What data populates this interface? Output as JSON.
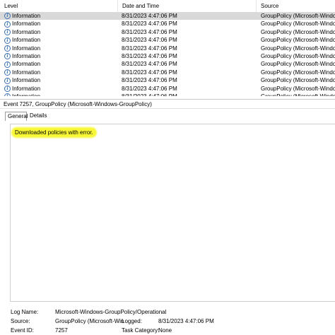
{
  "list": {
    "columns": [
      "Level",
      "Date and Time",
      "Source"
    ],
    "rows": [
      {
        "level": "Information",
        "date": "8/31/2023 4:47:06 PM",
        "source": "GroupPolicy (Microsoft-Windows",
        "selected": true
      },
      {
        "level": "Information",
        "date": "8/31/2023 4:47:06 PM",
        "source": "GroupPolicy (Microsoft-Windows"
      },
      {
        "level": "Information",
        "date": "8/31/2023 4:47:06 PM",
        "source": "GroupPolicy (Microsoft-Windows"
      },
      {
        "level": "Information",
        "date": "8/31/2023 4:47:06 PM",
        "source": "GroupPolicy (Microsoft-Windows"
      },
      {
        "level": "Information",
        "date": "8/31/2023 4:47:06 PM",
        "source": "GroupPolicy (Microsoft-Windows"
      },
      {
        "level": "Information",
        "date": "8/31/2023 4:47:06 PM",
        "source": "GroupPolicy (Microsoft-Windows"
      },
      {
        "level": "Information",
        "date": "8/31/2023 4:47:06 PM",
        "source": "GroupPolicy (Microsoft-Windows"
      },
      {
        "level": "Information",
        "date": "8/31/2023 4:47:06 PM",
        "source": "GroupPolicy (Microsoft-Windows"
      },
      {
        "level": "Information",
        "date": "8/31/2023 4:47:06 PM",
        "source": "GroupPolicy (Microsoft-Windows"
      },
      {
        "level": "Information",
        "date": "8/31/2023 4:47:06 PM",
        "source": "GroupPolicy (Microsoft-Windows"
      },
      {
        "level": "Information",
        "date": "8/31/2023 4:47:06 PM",
        "source": "GroupPolicy (Microsoft-Windows"
      }
    ]
  },
  "detail": {
    "title": "Event 7257, GroupPolicy (Microsoft-Windows-GroupPolicy)",
    "tabs": {
      "general": "General",
      "details": "Details"
    },
    "message": "Downloaded policies with error.",
    "highlight_color": "#f7f736"
  },
  "props": {
    "log_name_label": "Log Name:",
    "log_name_value": "Microsoft-Windows-GroupPolicy/Operational",
    "source_label": "Source:",
    "source_value": "GroupPolicy (Microsoft-Win",
    "logged_label": "Logged:",
    "logged_value": "8/31/2023 4:47:06 PM",
    "event_id_label": "Event ID:",
    "event_id_value": "7257",
    "task_category_label": "Task Category:",
    "task_category_value": "None"
  },
  "icons": {
    "row_icon": "information-icon"
  }
}
